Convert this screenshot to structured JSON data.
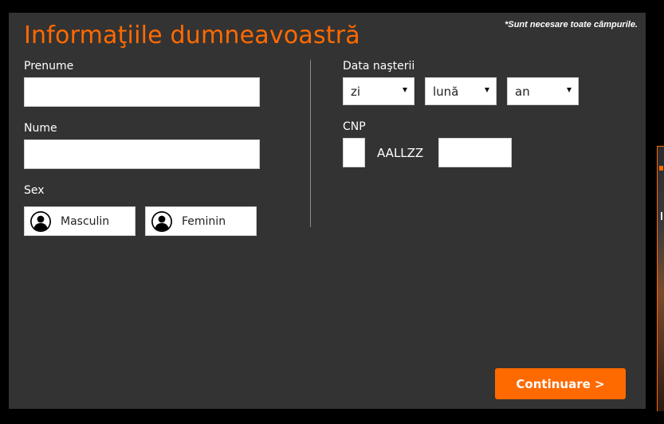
{
  "form": {
    "title": "Informaţiile dumneavoastră",
    "required_note": "*Sunt necesare toate câmpurile.",
    "first_name": {
      "label": "Prenume",
      "value": ""
    },
    "last_name": {
      "label": "Nume",
      "value": ""
    },
    "sex": {
      "label": "Sex",
      "options": [
        {
          "label": "Masculin",
          "icon": "user-avatar-icon"
        },
        {
          "label": "Feminin",
          "icon": "user-avatar-icon"
        }
      ]
    },
    "birth_date": {
      "label": "Data naşterii",
      "day": "zi",
      "month": "lună",
      "year": "an"
    },
    "cnp": {
      "label": "CNP",
      "first_digit": "",
      "date_part": "AALLZZ",
      "last_digits": ""
    },
    "continue_label": "Continuare >"
  },
  "colors": {
    "accent": "#ff6a00",
    "panel_background": "#333333",
    "page_background": "#000000",
    "text_light": "#ffffff"
  }
}
